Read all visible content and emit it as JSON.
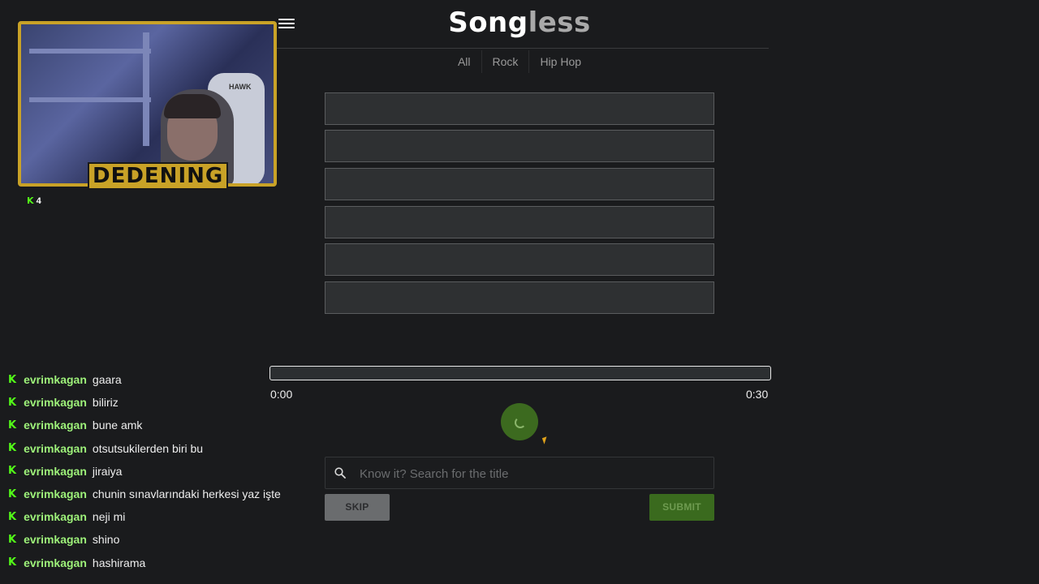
{
  "app": {
    "logo_part1": "Song",
    "logo_part2": "less"
  },
  "tabs": [
    "All",
    "Rock",
    "Hip Hop"
  ],
  "player": {
    "time_start": "0:00",
    "time_end": "0:30",
    "progress_fraction": 0.0
  },
  "search": {
    "placeholder": "Know it? Search for the title",
    "value": ""
  },
  "buttons": {
    "skip": "SKIP",
    "submit": "SUBMIT"
  },
  "stream": {
    "streamer_name": "DEDENING",
    "viewer_count": "4",
    "platform_icon": "K"
  },
  "chat": [
    {
      "user": "evrimkagan",
      "message": "gaara"
    },
    {
      "user": "evrimkagan",
      "message": "biliriz"
    },
    {
      "user": "evrimkagan",
      "message": "bune amk"
    },
    {
      "user": "evrimkagan",
      "message": "otsutsukilerden biri bu"
    },
    {
      "user": "evrimkagan",
      "message": "jiraiya"
    },
    {
      "user": "evrimkagan",
      "message": "chunin sınavlarındaki herkesi yaz işte"
    },
    {
      "user": "evrimkagan",
      "message": "neji mi"
    },
    {
      "user": "evrimkagan",
      "message": "shino"
    },
    {
      "user": "evrimkagan",
      "message": "hashirama"
    }
  ],
  "colors": {
    "background": "#1a1b1d",
    "accent_green": "#3a6a1e",
    "overlay_gold": "#c9a227",
    "chat_username": "#9ef27a"
  }
}
